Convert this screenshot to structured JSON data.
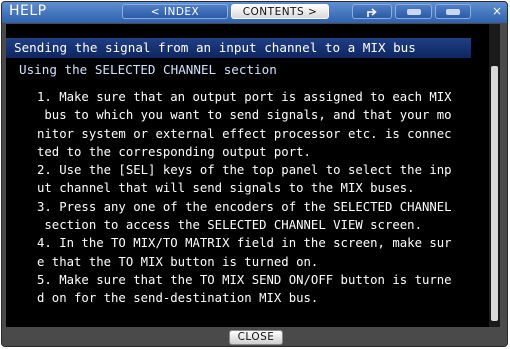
{
  "window": {
    "title": "HELP",
    "close_symbol": "×"
  },
  "toolbar": {
    "index_label": "< INDEX",
    "contents_label": "CONTENTS >",
    "up_icon": "up-arrow-icon",
    "back_icon": "back-icon",
    "forward_icon": "forward-icon",
    "accent_color": "#2f61ae"
  },
  "page": {
    "topic_title": "Sending the signal from an input channel to a MIX bus",
    "section_title": "Using the SELECTED CHANNEL section",
    "lines": [
      "1. Make sure that an output port is assigned to each MIX",
      " bus to which you want to send signals, and that your mo",
      "nitor system or external effect processor etc. is connec",
      "ted to the corresponding output port.",
      "2. Use the [SEL] keys of the top panel to select the inp",
      "ut channel that will send signals to the MIX buses.",
      "3. Press any one of the encoders of the SELECTED CHANNEL",
      " section to access the SELECTED CHANNEL VIEW screen.",
      "4. In the TO MIX/TO MATRIX field in the screen, make sur",
      "e that the TO MIX button is turned on.",
      "5. Make sure that the TO MIX SEND ON/OFF button is turne",
      "d on for the send-destination MIX bus."
    ]
  },
  "footer": {
    "close_label": "CLOSE"
  }
}
